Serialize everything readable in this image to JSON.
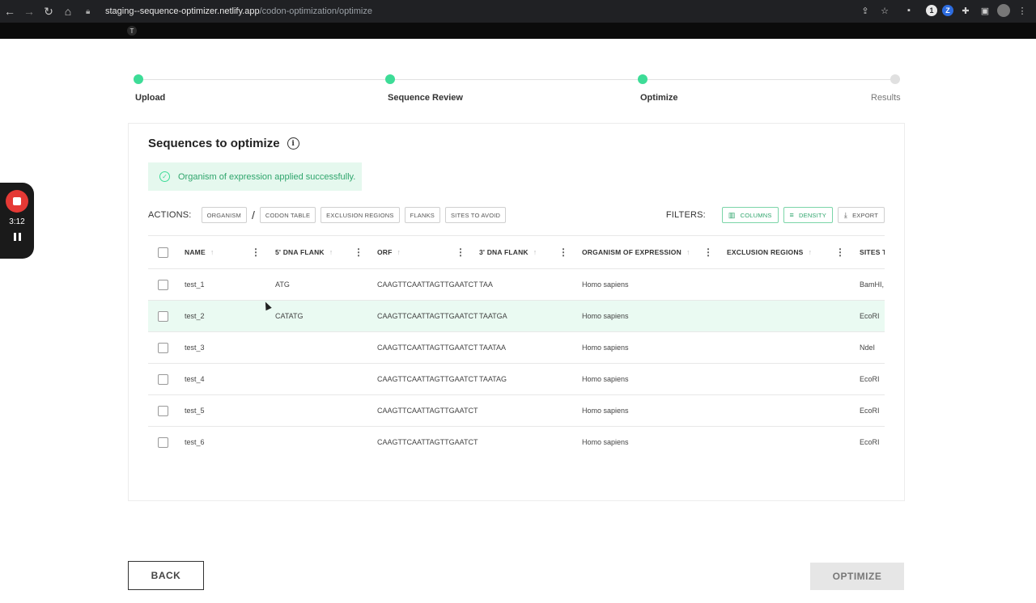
{
  "browser": {
    "url_domain": "staging--sequence-optimizer.netlify.app",
    "url_path": "/codon-optimization/optimize",
    "bookmark_icon": "T"
  },
  "recorder": {
    "time": "3:12"
  },
  "stepper": {
    "steps": [
      {
        "label": "Upload",
        "status": "done"
      },
      {
        "label": "Sequence Review",
        "status": "done"
      },
      {
        "label": "Optimize",
        "status": "done"
      },
      {
        "label": "Results",
        "status": "todo"
      }
    ]
  },
  "card": {
    "title": "Sequences to optimize",
    "alert": "Organism of expression applied successfully."
  },
  "actions": {
    "label": "ACTIONS:",
    "separator": "/",
    "buttons": [
      "ORGANISM",
      "CODON TABLE",
      "EXCLUSION REGIONS",
      "FLANKS",
      "SITES TO AVOID"
    ]
  },
  "filters": {
    "label": "FILTERS:",
    "buttons": [
      "COLUMNS",
      "DENSITY",
      "EXPORT"
    ]
  },
  "table": {
    "columns": [
      "NAME",
      "5' DNA FLANK",
      "ORF",
      "3' DNA FLANK",
      "ORGANISM OF EXPRESSION",
      "EXCLUSION REGIONS",
      "SITES T"
    ],
    "rows": [
      {
        "name": "test_1",
        "flank5": "ATG",
        "orf": "CAAGTTCAATTAGTTGAATCT",
        "flank3": "TAA",
        "organism": "Homo sapiens",
        "exclusion": "",
        "sites": "BamHI,"
      },
      {
        "name": "test_2",
        "flank5": "CATATG",
        "orf": "CAAGTTCAATTAGTTGAATCT",
        "flank3": "TAATGA",
        "organism": "Homo sapiens",
        "exclusion": "",
        "sites": "EcoRI"
      },
      {
        "name": "test_3",
        "flank5": "",
        "orf": "CAAGTTCAATTAGTTGAATCT",
        "flank3": "TAATAA",
        "organism": "Homo sapiens",
        "exclusion": "",
        "sites": "NdeI"
      },
      {
        "name": "test_4",
        "flank5": "",
        "orf": "CAAGTTCAATTAGTTGAATCT",
        "flank3": "TAATAG",
        "organism": "Homo sapiens",
        "exclusion": "",
        "sites": "EcoRI"
      },
      {
        "name": "test_5",
        "flank5": "",
        "orf": "CAAGTTCAATTAGTTGAATCT",
        "flank3": "",
        "organism": "Homo sapiens",
        "exclusion": "",
        "sites": "EcoRI"
      },
      {
        "name": "test_6",
        "flank5": "",
        "orf": "CAAGTTCAATTAGTTGAATCT",
        "flank3": "",
        "organism": "Homo sapiens",
        "exclusion": "",
        "sites": "EcoRI"
      }
    ]
  },
  "footer": {
    "back": "BACK",
    "optimize": "OPTIMIZE"
  },
  "colors": {
    "accent": "#3ddc97",
    "accent_text": "#2fa56c",
    "highlight_row": "#eafaf2"
  }
}
